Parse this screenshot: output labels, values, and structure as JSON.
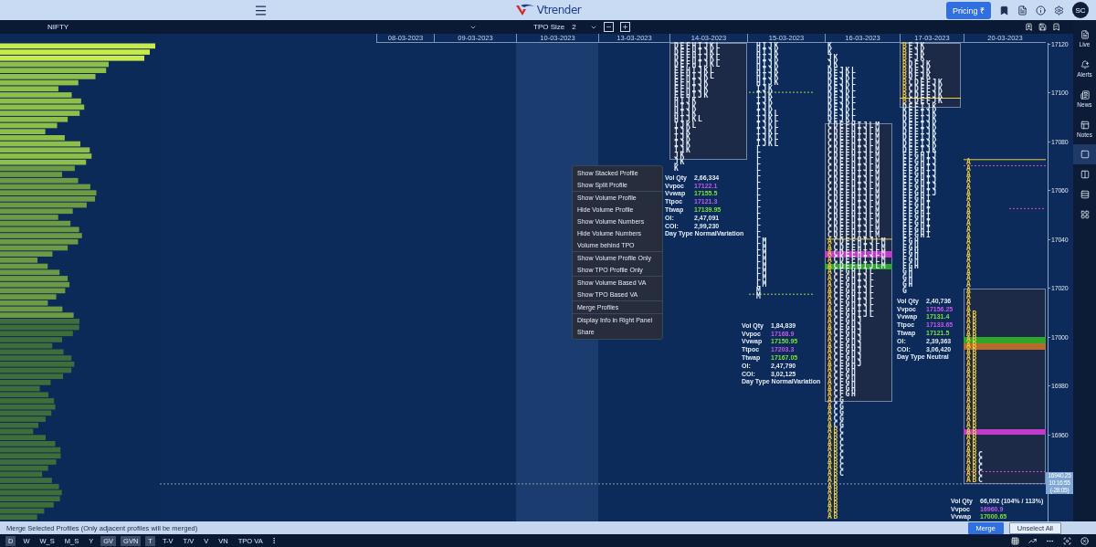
{
  "topbar": {
    "brand": "Vtrender",
    "pricing_button": "Pricing ₹",
    "avatar": "SC"
  },
  "toolbar": {
    "symbol": "NIFTY",
    "tpo_size_label": "TPO Size",
    "tpo_size": "2"
  },
  "dates": [
    {
      "label": "08-03-2023",
      "selected": false
    },
    {
      "label": "09-03-2023",
      "selected": false
    },
    {
      "label": "10-03-2023",
      "selected": true
    },
    {
      "label": "13-03-2023",
      "selected": false
    },
    {
      "label": "14-03-2023",
      "selected": false
    },
    {
      "label": "15-03-2023",
      "selected": false
    },
    {
      "label": "16-03-2023",
      "selected": false
    },
    {
      "label": "17-03-2023",
      "selected": false
    },
    {
      "label": "20-03-2023",
      "selected": false
    }
  ],
  "profiles": [
    {
      "rows": [
        "DEFHIJKL",
        "DEFHIJKL",
        "DEFHIJKL",
        "DEFHIJKL",
        "EFHIJKL",
        "EFHIJKL",
        "EFHIJK",
        "EFHIJK",
        "EFHIJK",
        "HIJK",
        "HIJK",
        "HIJK",
        "HIJKL",
        "IJKL",
        "IJK",
        "IJK",
        "IJK",
        "IJK",
        "JK",
        "JK",
        "K"
      ],
      "stats": [
        {
          "label": "Vol Qty",
          "value": "2,66,334",
          "color": "#e6edf7"
        },
        {
          "label": "Vvpoc",
          "value": "17122.1",
          "color": "#c659e8"
        },
        {
          "label": "Vvwap",
          "value": "17155.5",
          "color": "#7ee03c"
        },
        {
          "label": "Ttpoc",
          "value": "17121.3",
          "color": "#c659e8"
        },
        {
          "label": "Ttwap",
          "value": "17139.95",
          "color": "#7ee03c"
        },
        {
          "label": "OI:",
          "value": "2,47,091",
          "color": "#e6edf7"
        },
        {
          "label": "COI:",
          "value": "2,99,230",
          "color": "#e6edf7"
        },
        {
          "label": "Day Type",
          "value": "NormalVariation",
          "color": "#e6edf7"
        }
      ]
    },
    {
      "rows": [
        "HIJK",
        "HIJK",
        "HIJK",
        "HIJK",
        "HIJK",
        "HIJK",
        "HIJK",
        "IJK",
        "IJK",
        "IJK",
        "IJK",
        "IJKL",
        "IJKL",
        "IJKL",
        "IJKL",
        "IJKL",
        "IJKL",
        "L",
        "L",
        "L",
        "L",
        "L",
        "L",
        "L",
        "L",
        "L",
        "L",
        "L",
        "L",
        "L",
        "L",
        "L",
        "LM",
        "LM",
        "LM",
        "LM",
        "LM",
        "LM",
        "LM",
        "LM",
        "M",
        "M"
      ],
      "stats": [
        {
          "label": "Vol Qty",
          "value": "1,84,839",
          "color": "#e6edf7"
        },
        {
          "label": "Vvpoc",
          "value": "17168.9",
          "color": "#c659e8"
        },
        {
          "label": "Vvwap",
          "value": "17150.95",
          "color": "#7ee03c"
        },
        {
          "label": "Ttpoc",
          "value": "17203.3",
          "color": "#c659e8"
        },
        {
          "label": "Ttwap",
          "value": "17167.05",
          "color": "#7ee03c"
        },
        {
          "label": "OI:",
          "value": "2,47,790",
          "color": "#e6edf7"
        },
        {
          "label": "COI:",
          "value": "3,02,125",
          "color": "#e6edf7"
        },
        {
          "label": "Day Type",
          "value": "NormalVariation",
          "color": "#e6edf7"
        }
      ]
    },
    {
      "rows": [
        "K",
        "K",
        "JK",
        "JK",
        "DEJKL",
        "DEJKL",
        "DEJKL",
        "DEJKL",
        "DEJKL",
        "DEJKL",
        "DEJKL",
        "DEJKL",
        "DEJKL",
        "CDEFHIJLM",
        "CDEFHIJLM",
        "CDEFHIJLM",
        "CDEFHIJLM",
        "CDEFHIJLM",
        "CDEFHIJLM",
        "CDEFHIJLM",
        "CDEFHIJLM",
        "CDEFHIJLM",
        "CDEFHIJLM",
        "CDEFHIJLM",
        "CDEFHIJLM",
        "CDEFHIJLM",
        "CDEFHIJLM",
        "CDEFHIJLM",
        "CDEFHIJLM",
        "CDEFHIJLM",
        "CDEFHIJLM",
        "CDEFHIJLM",
        [
          "A",
          "CDEFHIJLM"
        ],
        [
          "A",
          "CDEFHIJLM"
        ],
        {
          "letters": [
            "A",
            "CDEFHIJLM"
          ],
          "kind": "poc"
        },
        [
          "A",
          "CDEFHIJLM"
        ],
        {
          "letters": [
            "A",
            "CDEFHIJLM"
          ],
          "kind": "vwap"
        },
        [
          "A",
          "CFGHIJL"
        ],
        [
          "A",
          "CFGHIJL"
        ],
        [
          "A",
          "CFGHIJL"
        ],
        [
          "A",
          "CFGHIJL"
        ],
        [
          "A",
          "CFGHIJL"
        ],
        [
          "A",
          "CFGHIJL"
        ],
        [
          "A",
          "CFGHIJL"
        ],
        [
          "A",
          "CFGHIJL"
        ],
        [
          "A",
          "CFGHJ"
        ],
        [
          "A",
          "CFGHJ"
        ],
        [
          "A",
          "CFGHJ"
        ],
        [
          "A",
          "CFGHJ"
        ],
        [
          "A",
          "CFGHJ"
        ],
        [
          "A",
          "CFGHJ"
        ],
        [
          "A",
          "CFGHJ"
        ],
        [
          "A",
          "CFGHJ"
        ],
        [
          "A",
          "CFGH"
        ],
        [
          "A",
          "CFGH"
        ],
        [
          "A",
          "CFGH"
        ],
        [
          "A",
          "CFGH"
        ],
        [
          "A",
          "CFGH"
        ],
        [
          "A",
          "CG"
        ],
        [
          "A",
          "CG"
        ],
        [
          "A",
          "CG"
        ],
        [
          "A",
          "CG"
        ],
        [
          "A",
          "CG"
        ],
        [
          "AB",
          "C"
        ],
        [
          "AB",
          "C"
        ],
        [
          "AB",
          "C"
        ],
        [
          "AB",
          "C"
        ],
        [
          "AB",
          "C"
        ],
        [
          "AB",
          "C"
        ],
        [
          "AB",
          "C"
        ],
        [
          "AB",
          "C"
        ],
        [
          "AB"
        ],
        [
          "AB"
        ],
        [
          "AB"
        ],
        [
          "AB"
        ],
        [
          "AB"
        ],
        [
          "AB"
        ],
        [
          "AB"
        ]
      ]
    },
    {
      "rows": [
        [
          "B",
          "FJK"
        ],
        [
          "B",
          "FJK"
        ],
        [
          "B",
          "FJK"
        ],
        [
          "B",
          "DFJK"
        ],
        [
          "B",
          "DFJK"
        ],
        [
          "B",
          "DFJK"
        ],
        [
          "B",
          "CDEFJK"
        ],
        [
          "B",
          "CDEFJK"
        ],
        {
          "letters": [
            "B",
            "CDEFJK"
          ],
          "kind": "vwap_line"
        },
        [
          "B",
          "CDEFJK"
        ],
        "DEFIJK",
        "DEFIJK",
        "DEFIJK",
        "DEFIJK",
        "DEFIJK",
        "DEFIJK",
        "DEFIJK",
        "DEFIJK",
        "EFGHIJ",
        "EFGHIJ",
        "EFGHIJ",
        "EFGHIJ",
        "EFGHIJ",
        "EFGHIJ",
        "EFGHIJ",
        "EFGHI",
        "EFGHI",
        "EFGHI",
        "EFGHI",
        "EFGHI",
        "EFGHI",
        "EFGHI",
        "FGH",
        "FGH",
        "FGH",
        "FGH",
        "FGH",
        "GH",
        "GH",
        "GH",
        "G"
      ],
      "stats": [
        {
          "label": "Vol Qty",
          "value": "2,40,736",
          "color": "#e6edf7"
        },
        {
          "label": "Vvpoc",
          "value": "17156.25",
          "color": "#c659e8"
        },
        {
          "label": "Vvwap",
          "value": "17131.4",
          "color": "#7ee03c"
        },
        {
          "label": "Ttpoc",
          "value": "17133.65",
          "color": "#c659e8"
        },
        {
          "label": "Ttwap",
          "value": "17121.5",
          "color": "#7ee03c"
        },
        {
          "label": "OI:",
          "value": "2,39,363",
          "color": "#e6edf7"
        },
        {
          "label": "COI:",
          "value": "3,06,420",
          "color": "#e6edf7"
        },
        {
          "label": "Day Type",
          "value": "Neutral",
          "color": "#e6edf7"
        }
      ]
    },
    {
      "rows": [
        [
          "A"
        ],
        [
          "A"
        ],
        [
          "A"
        ],
        [
          "A"
        ],
        [
          "A"
        ],
        [
          "A"
        ],
        [
          "A"
        ],
        [
          "A"
        ],
        [
          "A"
        ],
        [
          "A"
        ],
        [
          "A"
        ],
        [
          "A"
        ],
        [
          "A"
        ],
        [
          "A"
        ],
        [
          "A"
        ],
        [
          "A"
        ],
        [
          "A"
        ],
        [
          "A"
        ],
        [
          "A"
        ],
        [
          "A"
        ],
        [
          "A"
        ],
        [
          "A"
        ],
        [
          "A"
        ],
        [
          "A"
        ],
        [
          "A"
        ],
        [
          "AB"
        ],
        [
          "AB"
        ],
        [
          "AB"
        ],
        [
          "AB"
        ],
        {
          "letters": [
            "AB"
          ],
          "kind": "vwap"
        },
        {
          "letters": [
            "AB"
          ],
          "kind": "level"
        },
        [
          "AB"
        ],
        [
          "AB"
        ],
        [
          "AB"
        ],
        [
          "AB"
        ],
        [
          "AB"
        ],
        [
          "AB"
        ],
        [
          "AB"
        ],
        [
          "AB"
        ],
        [
          "AB"
        ],
        [
          "AB"
        ],
        [
          "AB"
        ],
        [
          "AB"
        ],
        [
          "AB"
        ],
        {
          "letters": [
            "AB"
          ],
          "kind": "poc"
        },
        [
          "AB"
        ],
        [
          "AB"
        ],
        [
          "AB"
        ],
        [
          "AB",
          "C"
        ],
        [
          "AB",
          "C"
        ],
        [
          "AB",
          "C"
        ],
        [
          "AB",
          "C"
        ],
        [
          "AB",
          "C"
        ]
      ],
      "stats": [
        {
          "label": "Vol Qty",
          "value": "66,092 (104% / 113%)",
          "color": "#e6edf7"
        },
        {
          "label": "Vvpoc",
          "value": "16960.9",
          "color": "#c659e8"
        },
        {
          "label": "Vvwap",
          "value": "17000.65",
          "color": "#7ee03c"
        }
      ]
    }
  ],
  "price_axis": {
    "ticks": [
      "17120",
      "17100",
      "17080",
      "17060",
      "17040",
      "17020",
      "17000",
      "16980",
      "16960"
    ],
    "price_tag": [
      "16940.25",
      "10:16:55",
      "(-28:05)"
    ]
  },
  "context_menu": {
    "groups": [
      [
        "Show Stacked Profile",
        "Show Split Profile"
      ],
      [
        "Show Volume Profile",
        "Hide Volume Profile",
        "Show Volume Numbers",
        "Hide Volume Numbers",
        "Volume behind TPO"
      ],
      [
        "Show Volume Profile Only",
        "Show TPO Profile Only"
      ],
      [
        "Show Volume Based VA",
        "Show TPO Based VA"
      ],
      [
        "Merge Profiles"
      ],
      [
        "Display Info in Right Panel",
        "Share"
      ]
    ]
  },
  "sidebar": {
    "items": [
      {
        "label": "Live",
        "selected": false
      },
      {
        "label": "Alerts",
        "selected": false
      },
      {
        "label": "News",
        "selected": false
      },
      {
        "label": "Notes",
        "selected": false
      },
      {
        "selected": true
      },
      {
        "selected": false
      },
      {
        "selected": false
      },
      {
        "selected": false
      }
    ]
  },
  "merge_bar": {
    "message": "Merge Selected Profiles (Only adjacent profiles will be merged)",
    "buttons": [
      {
        "label": "Merge",
        "kind": "primary"
      },
      {
        "label": "Unselect All",
        "kind": "secondary"
      }
    ]
  },
  "bottom_bar": {
    "tabs": [
      {
        "label": "D",
        "on": true
      },
      {
        "label": "W",
        "on": false
      },
      {
        "label": "W_S",
        "on": false
      },
      {
        "label": "M_S",
        "on": false
      },
      {
        "label": "Y",
        "on": false
      },
      {
        "label": "GV",
        "on": true
      },
      {
        "label": "GVN",
        "on": true
      },
      {
        "label": "T",
        "on": true
      },
      {
        "label": "T-V",
        "on": false
      },
      {
        "label": "T/V",
        "on": false
      },
      {
        "label": "V",
        "on": false
      },
      {
        "label": "VN",
        "on": false
      },
      {
        "label": "TPO VA",
        "on": false
      }
    ]
  }
}
